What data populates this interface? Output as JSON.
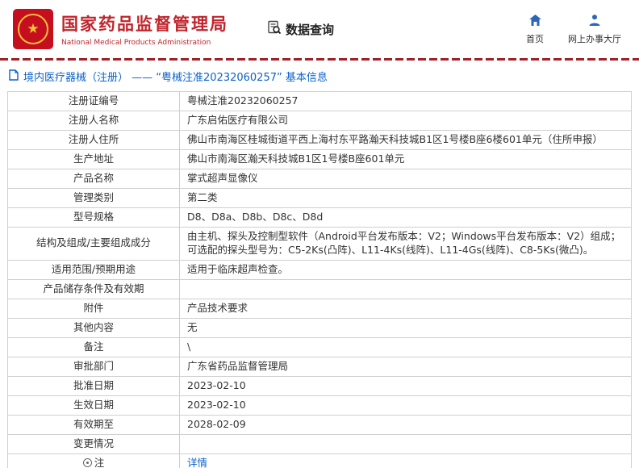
{
  "colors": {
    "brand_red": "#c0242c",
    "divider_red": "#9e2227",
    "link_blue": "#0a62c9",
    "table_border": "#cfcfcf"
  },
  "icons": {
    "emblem": "national-emblem-icon",
    "data_query": "doc-search-icon",
    "home": "home-icon",
    "service_hall": "person-icon",
    "breadcrumb": "document-icon",
    "note": "note-icon"
  },
  "header": {
    "agency_cn": "国家药品监督管理局",
    "agency_en": "National Medical Products Administration",
    "data_query": "数据查询",
    "nav_home": "首页",
    "nav_hall": "网上办事大厅"
  },
  "breadcrumb": {
    "text": "境内医疗器械（注册） ——  “粤械注准20232060257”  基本信息"
  },
  "table": {
    "rows": [
      {
        "label": "注册证编号",
        "value": "粤械注准20232060257"
      },
      {
        "label": "注册人名称",
        "value": "广东启佑医疗有限公司"
      },
      {
        "label": "注册人住所",
        "value": "佛山市南海区桂城街道平西上海村东平路瀚天科技城B1区1号楼B座6楼601单元（住所申报）"
      },
      {
        "label": "生产地址",
        "value": "佛山市南海区瀚天科技城B1区1号楼B座601单元"
      },
      {
        "label": "产品名称",
        "value": "掌式超声显像仪"
      },
      {
        "label": "管理类别",
        "value": "第二类"
      },
      {
        "label": "型号规格",
        "value": "D8、D8a、D8b、D8c、D8d"
      },
      {
        "label": "结构及组成/主要组成成分",
        "value": "由主机、探头及控制型软件（Android平台发布版本：V2；Windows平台发布版本：V2）组成；可选配的探头型号为：C5-2Ks(凸阵)、L11-4Ks(线阵)、L11-4Gs(线阵)、C8-5Ks(微凸)。"
      },
      {
        "label": "适用范围/预期用途",
        "value": "适用于临床超声检查。"
      },
      {
        "label": "产品储存条件及有效期",
        "value": ""
      },
      {
        "label": "附件",
        "value": "产品技术要求"
      },
      {
        "label": "其他内容",
        "value": "无"
      },
      {
        "label": "备注",
        "value": "\\"
      },
      {
        "label": "审批部门",
        "value": "广东省药品监督管理局"
      },
      {
        "label": "批准日期",
        "value": "2023-02-10"
      },
      {
        "label": "生效日期",
        "value": "2023-02-10"
      },
      {
        "label": "有效期至",
        "value": "2028-02-09"
      },
      {
        "label": "变更情况",
        "value": ""
      },
      {
        "label": "注",
        "icon": true,
        "value": "详情",
        "link": true
      }
    ]
  }
}
